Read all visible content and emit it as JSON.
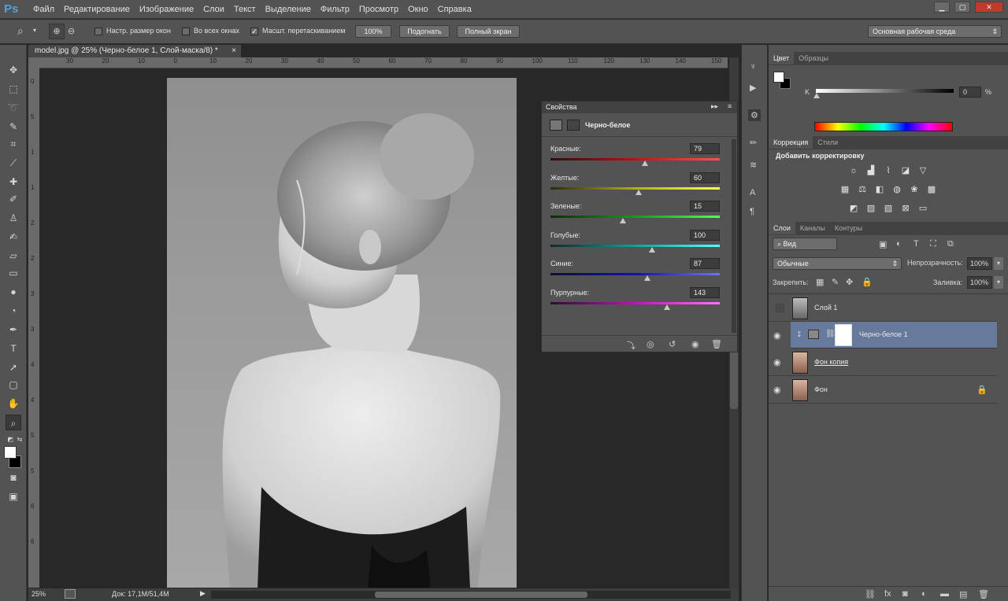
{
  "app": {
    "logo": "Ps"
  },
  "menu": [
    "Файл",
    "Редактирование",
    "Изображение",
    "Слои",
    "Текст",
    "Выделение",
    "Фильтр",
    "Просмотр",
    "Окно",
    "Справка"
  ],
  "window_buttons": {
    "minimize": "▁",
    "maximize": "▢",
    "close": "✕"
  },
  "options": {
    "resize_windows": "Настр. размер окон",
    "all_windows": "Во всех окнах",
    "scrubby_zoom": "Масшт. перетаскиванием",
    "btn_100": "100%",
    "btn_fit": "Подогнать",
    "btn_fullscreen": "Полный экран",
    "workspace": "Основная рабочая среда"
  },
  "document": {
    "tab_title": "model.jpg @ 25% (Черно-белое 1, Слой-маска/8) *",
    "tab_close": "×",
    "zoom": "25%",
    "doc_info": "Док: 17,1M/51,4M",
    "ruler_h": [
      "30",
      "20",
      "10",
      "0",
      "10",
      "20",
      "30",
      "40",
      "50",
      "60",
      "70",
      "80",
      "90",
      "100",
      "110",
      "120",
      "130",
      "140",
      "150",
      "160"
    ],
    "ruler_v": [
      "0",
      "5",
      "1",
      "1",
      "2",
      "2",
      "3",
      "3",
      "4",
      "4",
      "5",
      "5",
      "6",
      "6"
    ]
  },
  "properties": {
    "title": "Свойства",
    "subtitle": "Черно-белое",
    "sliders": [
      {
        "label": "Красные:",
        "value": "79",
        "pos": 0.56,
        "grad": "linear-gradient(90deg,#2a1010,#c01010,#ff5050)"
      },
      {
        "label": "Желтые:",
        "value": "60",
        "pos": 0.52,
        "grad": "linear-gradient(90deg,#2a2a10,#b0b010,#ffff50)"
      },
      {
        "label": "Зеленые:",
        "value": "15",
        "pos": 0.43,
        "grad": "linear-gradient(90deg,#102a10,#10a010,#50ff50)"
      },
      {
        "label": "Голубые:",
        "value": "100",
        "pos": 0.6,
        "grad": "linear-gradient(90deg,#102a2a,#10a0a0,#50ffff)"
      },
      {
        "label": "Синие:",
        "value": "87",
        "pos": 0.57,
        "grad": "linear-gradient(90deg,#10102a,#1010c0,#7070ff)"
      },
      {
        "label": "Пурпурные:",
        "value": "143",
        "pos": 0.69,
        "grad": "linear-gradient(90deg,#2a102a,#c010c0,#ff70ff)"
      }
    ]
  },
  "color_panel": {
    "tabs": [
      "Цвет",
      "Образцы"
    ],
    "channel": "K",
    "value": "0",
    "unit": "%"
  },
  "adjustments": {
    "tabs": [
      "Коррекция",
      "Стили"
    ],
    "title": "Добавить корректировку"
  },
  "layers_panel": {
    "tabs": [
      "Слои",
      "Каналы",
      "Контуры"
    ],
    "filter": "Вид",
    "blend_mode": "Обычные",
    "opacity_label": "Непрозрачность:",
    "opacity": "100%",
    "lock_label": "Закрепить:",
    "fill_label": "Заливка:",
    "fill": "100%",
    "layers": [
      {
        "name": "Слой 1",
        "visible": false,
        "selected": false
      },
      {
        "name": "Черно-белое 1",
        "visible": true,
        "selected": true
      },
      {
        "name": "Фон копия",
        "visible": true,
        "selected": false
      },
      {
        "name": "Фон",
        "visible": true,
        "selected": false
      }
    ]
  },
  "colors": {
    "accent": "#4aa0e6",
    "selected_layer": "#677a9c"
  }
}
